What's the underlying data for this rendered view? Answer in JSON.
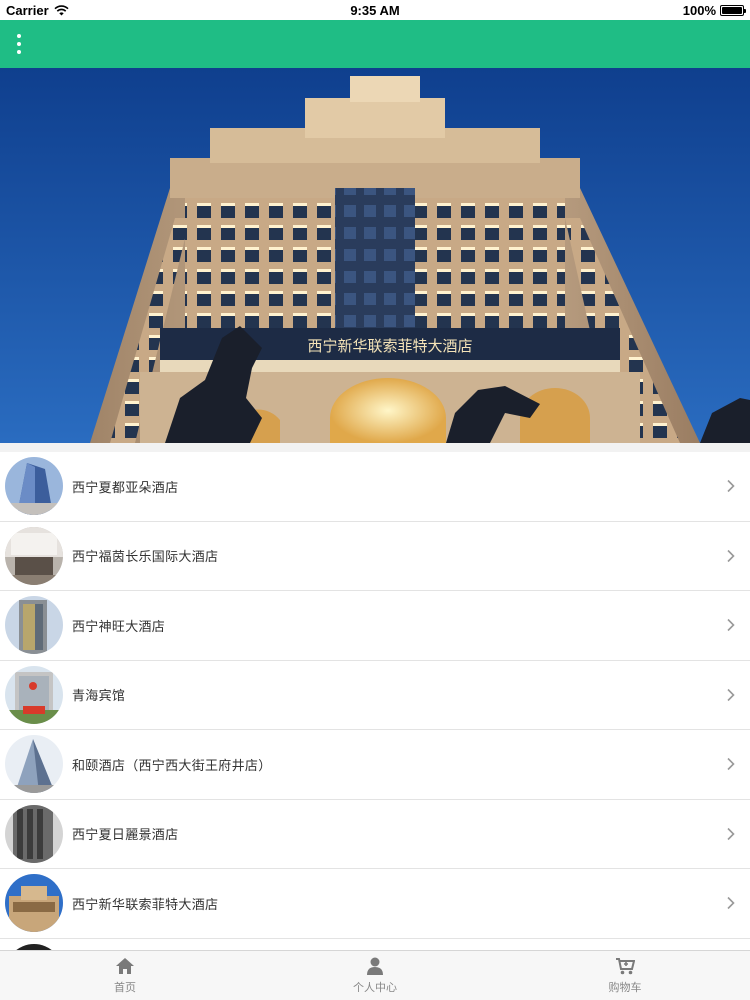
{
  "status_bar": {
    "carrier": "Carrier",
    "time": "9:35 AM",
    "battery": "100%",
    "battery_level": 1.0,
    "wifi_icon": "wifi-icon"
  },
  "nav_bar": {
    "background": "#1fbd85",
    "menu_icon": "more-vertical-icon"
  },
  "hero": {
    "image": "hotel-facade-photo",
    "sign_text": "西宁新华联索菲特大酒店"
  },
  "hotels": [
    {
      "name": "西宁夏都亚朵酒店"
    },
    {
      "name": "西宁福茵长乐国际大酒店"
    },
    {
      "name": "西宁神旺大酒店"
    },
    {
      "name": "青海宾馆"
    },
    {
      "name": "和颐酒店（西宁西大街王府井店）"
    },
    {
      "name": "西宁夏日麗景酒店"
    },
    {
      "name": "西宁新华联索菲特大酒店"
    }
  ],
  "tab_bar": {
    "tabs": [
      {
        "label": "首页",
        "icon": "home-icon"
      },
      {
        "label": "个人中心",
        "icon": "user-icon"
      },
      {
        "label": "购物车",
        "icon": "cart-icon"
      }
    ]
  }
}
